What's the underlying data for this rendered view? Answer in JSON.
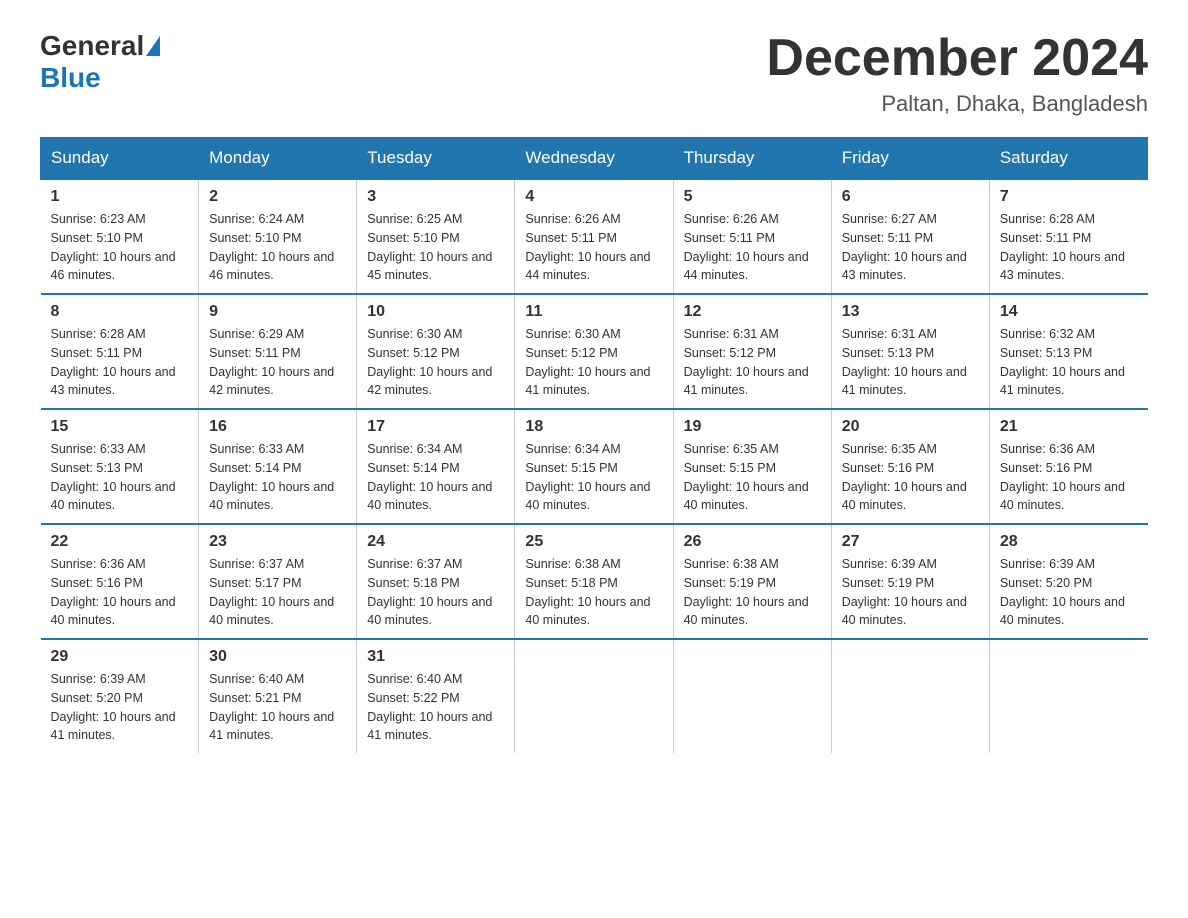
{
  "header": {
    "logo_general": "General",
    "logo_blue": "Blue",
    "month_title": "December 2024",
    "location": "Paltan, Dhaka, Bangladesh"
  },
  "weekdays": [
    "Sunday",
    "Monday",
    "Tuesday",
    "Wednesday",
    "Thursday",
    "Friday",
    "Saturday"
  ],
  "weeks": [
    [
      {
        "day": "1",
        "sunrise": "6:23 AM",
        "sunset": "5:10 PM",
        "daylight": "10 hours and 46 minutes."
      },
      {
        "day": "2",
        "sunrise": "6:24 AM",
        "sunset": "5:10 PM",
        "daylight": "10 hours and 46 minutes."
      },
      {
        "day": "3",
        "sunrise": "6:25 AM",
        "sunset": "5:10 PM",
        "daylight": "10 hours and 45 minutes."
      },
      {
        "day": "4",
        "sunrise": "6:26 AM",
        "sunset": "5:11 PM",
        "daylight": "10 hours and 44 minutes."
      },
      {
        "day": "5",
        "sunrise": "6:26 AM",
        "sunset": "5:11 PM",
        "daylight": "10 hours and 44 minutes."
      },
      {
        "day": "6",
        "sunrise": "6:27 AM",
        "sunset": "5:11 PM",
        "daylight": "10 hours and 43 minutes."
      },
      {
        "day": "7",
        "sunrise": "6:28 AM",
        "sunset": "5:11 PM",
        "daylight": "10 hours and 43 minutes."
      }
    ],
    [
      {
        "day": "8",
        "sunrise": "6:28 AM",
        "sunset": "5:11 PM",
        "daylight": "10 hours and 43 minutes."
      },
      {
        "day": "9",
        "sunrise": "6:29 AM",
        "sunset": "5:11 PM",
        "daylight": "10 hours and 42 minutes."
      },
      {
        "day": "10",
        "sunrise": "6:30 AM",
        "sunset": "5:12 PM",
        "daylight": "10 hours and 42 minutes."
      },
      {
        "day": "11",
        "sunrise": "6:30 AM",
        "sunset": "5:12 PM",
        "daylight": "10 hours and 41 minutes."
      },
      {
        "day": "12",
        "sunrise": "6:31 AM",
        "sunset": "5:12 PM",
        "daylight": "10 hours and 41 minutes."
      },
      {
        "day": "13",
        "sunrise": "6:31 AM",
        "sunset": "5:13 PM",
        "daylight": "10 hours and 41 minutes."
      },
      {
        "day": "14",
        "sunrise": "6:32 AM",
        "sunset": "5:13 PM",
        "daylight": "10 hours and 41 minutes."
      }
    ],
    [
      {
        "day": "15",
        "sunrise": "6:33 AM",
        "sunset": "5:13 PM",
        "daylight": "10 hours and 40 minutes."
      },
      {
        "day": "16",
        "sunrise": "6:33 AM",
        "sunset": "5:14 PM",
        "daylight": "10 hours and 40 minutes."
      },
      {
        "day": "17",
        "sunrise": "6:34 AM",
        "sunset": "5:14 PM",
        "daylight": "10 hours and 40 minutes."
      },
      {
        "day": "18",
        "sunrise": "6:34 AM",
        "sunset": "5:15 PM",
        "daylight": "10 hours and 40 minutes."
      },
      {
        "day": "19",
        "sunrise": "6:35 AM",
        "sunset": "5:15 PM",
        "daylight": "10 hours and 40 minutes."
      },
      {
        "day": "20",
        "sunrise": "6:35 AM",
        "sunset": "5:16 PM",
        "daylight": "10 hours and 40 minutes."
      },
      {
        "day": "21",
        "sunrise": "6:36 AM",
        "sunset": "5:16 PM",
        "daylight": "10 hours and 40 minutes."
      }
    ],
    [
      {
        "day": "22",
        "sunrise": "6:36 AM",
        "sunset": "5:16 PM",
        "daylight": "10 hours and 40 minutes."
      },
      {
        "day": "23",
        "sunrise": "6:37 AM",
        "sunset": "5:17 PM",
        "daylight": "10 hours and 40 minutes."
      },
      {
        "day": "24",
        "sunrise": "6:37 AM",
        "sunset": "5:18 PM",
        "daylight": "10 hours and 40 minutes."
      },
      {
        "day": "25",
        "sunrise": "6:38 AM",
        "sunset": "5:18 PM",
        "daylight": "10 hours and 40 minutes."
      },
      {
        "day": "26",
        "sunrise": "6:38 AM",
        "sunset": "5:19 PM",
        "daylight": "10 hours and 40 minutes."
      },
      {
        "day": "27",
        "sunrise": "6:39 AM",
        "sunset": "5:19 PM",
        "daylight": "10 hours and 40 minutes."
      },
      {
        "day": "28",
        "sunrise": "6:39 AM",
        "sunset": "5:20 PM",
        "daylight": "10 hours and 40 minutes."
      }
    ],
    [
      {
        "day": "29",
        "sunrise": "6:39 AM",
        "sunset": "5:20 PM",
        "daylight": "10 hours and 41 minutes."
      },
      {
        "day": "30",
        "sunrise": "6:40 AM",
        "sunset": "5:21 PM",
        "daylight": "10 hours and 41 minutes."
      },
      {
        "day": "31",
        "sunrise": "6:40 AM",
        "sunset": "5:22 PM",
        "daylight": "10 hours and 41 minutes."
      },
      null,
      null,
      null,
      null
    ]
  ],
  "labels": {
    "sunrise_prefix": "Sunrise: ",
    "sunset_prefix": "Sunset: ",
    "daylight_prefix": "Daylight: "
  }
}
